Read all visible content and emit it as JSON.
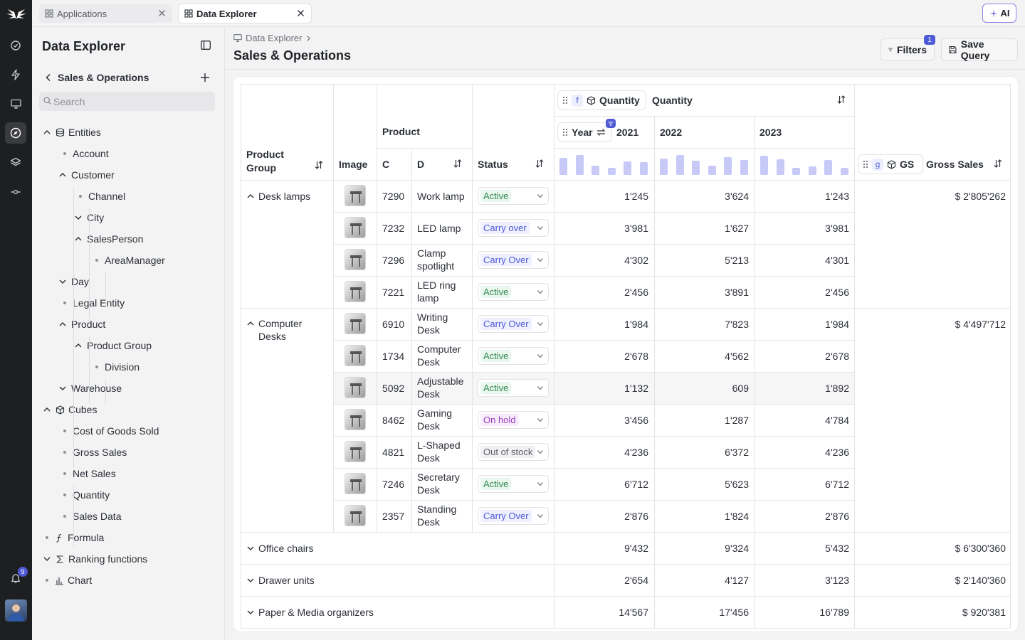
{
  "app": {
    "notifications_count": "9",
    "ai_label": "AI"
  },
  "tabs": [
    {
      "label": "Applications",
      "active": false
    },
    {
      "label": "Data Explorer",
      "active": true
    }
  ],
  "sidebar": {
    "title": "Data Explorer",
    "model": "Sales & Operations",
    "search_placeholder": "Search",
    "tree": [
      {
        "label": "Entities",
        "level": 0,
        "kind": "expanded",
        "icon": "database-icon"
      },
      {
        "label": "Account",
        "level": 1,
        "kind": "leaf"
      },
      {
        "label": "Customer",
        "level": 1,
        "kind": "expanded"
      },
      {
        "label": "Channel",
        "level": 2,
        "kind": "leaf"
      },
      {
        "label": "City",
        "level": 2,
        "kind": "collapsed"
      },
      {
        "label": "SalesPerson",
        "level": 2,
        "kind": "expanded"
      },
      {
        "label": "AreaManager",
        "level": 3,
        "kind": "leaf"
      },
      {
        "label": "Day",
        "level": 1,
        "kind": "collapsed"
      },
      {
        "label": "Legal Entity",
        "level": 1,
        "kind": "leaf"
      },
      {
        "label": "Product",
        "level": 1,
        "kind": "expanded"
      },
      {
        "label": "Product Group",
        "level": 2,
        "kind": "expanded"
      },
      {
        "label": "Division",
        "level": 3,
        "kind": "leaf"
      },
      {
        "label": "Warehouse",
        "level": 1,
        "kind": "collapsed"
      },
      {
        "label": "Cubes",
        "level": 0,
        "kind": "expanded",
        "icon": "cube-icon"
      },
      {
        "label": "Cost of Goods Sold",
        "level": 1,
        "kind": "leaf"
      },
      {
        "label": "Gross Sales",
        "level": 1,
        "kind": "leaf"
      },
      {
        "label": "Net Sales",
        "level": 1,
        "kind": "leaf"
      },
      {
        "label": "Quantity",
        "level": 1,
        "kind": "leaf"
      },
      {
        "label": "Sales Data",
        "level": 1,
        "kind": "leaf"
      },
      {
        "label": "Formula",
        "level": 0,
        "kind": "leaf",
        "icon": "function-icon"
      },
      {
        "label": "Ranking functions",
        "level": 0,
        "kind": "collapsed",
        "icon": "sigma-icon"
      },
      {
        "label": "Chart",
        "level": 0,
        "kind": "leaf",
        "icon": "chart-icon"
      }
    ]
  },
  "header": {
    "breadcrumb": "Data Explorer",
    "title": "Sales & Operations",
    "filters_label": "Filters",
    "filters_count": "1",
    "save_label": "Save Query"
  },
  "grid": {
    "col_product_group": "Product Group",
    "col_image": "Image",
    "col_product": "Product",
    "col_c": "C",
    "col_d": "D",
    "col_status": "Status",
    "quantity_chip_badge": "f",
    "quantity_chip": "Quantity",
    "quantity_label": "Quantity",
    "year_chip": "Year",
    "years": [
      "2021",
      "2022",
      "2023"
    ],
    "gs_chip_badge": "g",
    "gs_chip": "GS",
    "gs_label": "Gross Sales",
    "colors": {
      "bar": "#c7caf7",
      "accent": "#4f5bd5"
    },
    "groups": [
      {
        "label": "Desk lamps",
        "expanded": true,
        "total": "$ 2'805'262",
        "rows": [
          {
            "c": "7290",
            "d": "Work lamp",
            "status": "Active",
            "q2021": "1'245",
            "q2022": "3'624",
            "q2023": "1'243"
          },
          {
            "c": "7232",
            "d": "LED lamp",
            "status": "Carry over",
            "q2021": "3'981",
            "q2022": "1'627",
            "q2023": "3'981"
          },
          {
            "c": "7296",
            "d": "Clamp spotlight",
            "status": "Carry Over",
            "q2021": "4'302",
            "q2022": "5'213",
            "q2023": "4'301"
          },
          {
            "c": "7221",
            "d": "LED ring lamp",
            "status": "Active",
            "q2021": "2'456",
            "q2022": "3'891",
            "q2023": "2'456"
          }
        ]
      },
      {
        "label": "Computer Desks",
        "expanded": true,
        "total": "$ 4'497'712",
        "rows": [
          {
            "c": "6910",
            "d": "Writing Desk",
            "status": "Carry Over",
            "q2021": "1'984",
            "q2022": "7'823",
            "q2023": "1'984"
          },
          {
            "c": "1734",
            "d": "Computer Desk",
            "status": "Active",
            "q2021": "2'678",
            "q2022": "4'562",
            "q2023": "2'678"
          },
          {
            "c": "5092",
            "d": "Adjustable Desk",
            "status": "Active",
            "q2021": "1'132",
            "q2022": "609",
            "q2023": "1'892"
          },
          {
            "c": "8462",
            "d": "Gaming Desk",
            "status": "On hold",
            "q2021": "3'456",
            "q2022": "1'287",
            "q2023": "4'784"
          },
          {
            "c": "4821",
            "d": "L-Shaped Desk",
            "status": "Out of stock",
            "q2021": "4'236",
            "q2022": "6'372",
            "q2023": "4'236"
          },
          {
            "c": "7246",
            "d": "Secretary Desk",
            "status": "Active",
            "q2021": "6'712",
            "q2022": "5'623",
            "q2023": "6'712"
          },
          {
            "c": "2357",
            "d": "Standing Desk",
            "status": "Carry Over",
            "q2021": "2'876",
            "q2022": "1'824",
            "q2023": "2'876"
          }
        ]
      },
      {
        "label": "Office chairs",
        "expanded": false,
        "total": "$ 6'300'360",
        "q2021": "9'432",
        "q2022": "9'324",
        "q2023": "5'432"
      },
      {
        "label": "Drawer units",
        "expanded": false,
        "total": "$ 2'140'360",
        "q2021": "2'654",
        "q2022": "4'127",
        "q2023": "3'123"
      },
      {
        "label": "Paper & Media organizers",
        "expanded": false,
        "total": "$ 920'381",
        "q2021": "14'567",
        "q2022": "17'456",
        "q2023": "16'789"
      }
    ]
  },
  "sparkline": {
    "2021": [
      0.75,
      0.88,
      0.42,
      0.3,
      0.58,
      0.55
    ],
    "2022": [
      0.72,
      0.88,
      0.62,
      0.42,
      0.78,
      0.65
    ],
    "2023": [
      0.83,
      0.7,
      0.32,
      0.38,
      0.65,
      0.3
    ]
  }
}
